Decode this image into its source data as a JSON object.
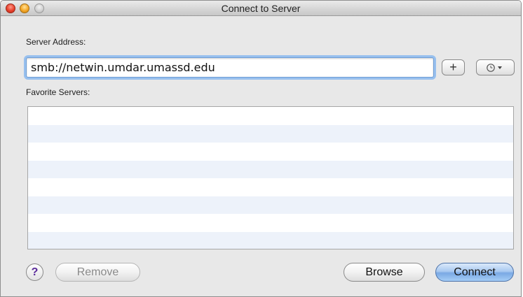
{
  "window": {
    "title": "Connect to Server"
  },
  "server_address": {
    "label": "Server Address:",
    "value": "smb://netwin.umdar.umassd.edu"
  },
  "favorites": {
    "label": "Favorite Servers:",
    "rows": [
      "",
      "",
      "",
      "",
      "",
      "",
      "",
      ""
    ]
  },
  "buttons": {
    "add": "+",
    "help": "?",
    "remove": "Remove",
    "browse": "Browse",
    "connect": "Connect"
  },
  "colors": {
    "focus_ring": "#98c0ee",
    "default_button": "#a9c9f0",
    "row_stripe": "#edf2fa"
  }
}
